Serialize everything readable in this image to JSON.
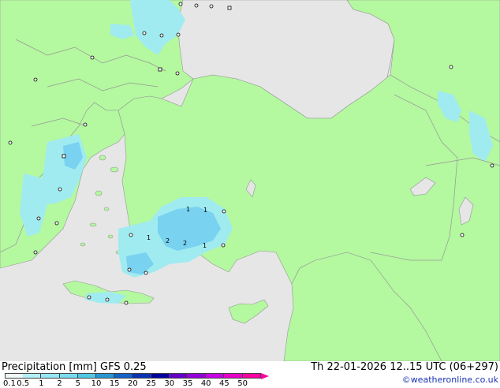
{
  "footer": {
    "title_left": "Precipitation [mm] GFS 0.25",
    "title_right": "Th 22-01-2026 12..15 UTC (06+297)",
    "credit": "©weatheronline.co.uk"
  },
  "legend": {
    "ticks": [
      "0.1",
      "0.5",
      "1",
      "2",
      "5",
      "10",
      "15",
      "20",
      "25",
      "30",
      "35",
      "40",
      "45",
      "50"
    ],
    "colors": [
      "#f0fafa",
      "#b4f0fa",
      "#96e6f5",
      "#78dcf0",
      "#50c8e6",
      "#2896d2",
      "#1464c8",
      "#0a32b4",
      "#0000a0",
      "#6400c8",
      "#9600dc",
      "#c800e6",
      "#e600c8",
      "#fa00a0"
    ]
  },
  "map": {
    "colors": {
      "land": "#b4f8a0",
      "sea": "#e6e6e6",
      "precip_light": "#a0ebf0",
      "precip_medium": "#78d2f0",
      "border": "#969696"
    },
    "labels": [
      "1",
      "1",
      "1",
      "2",
      "2",
      "1"
    ]
  }
}
